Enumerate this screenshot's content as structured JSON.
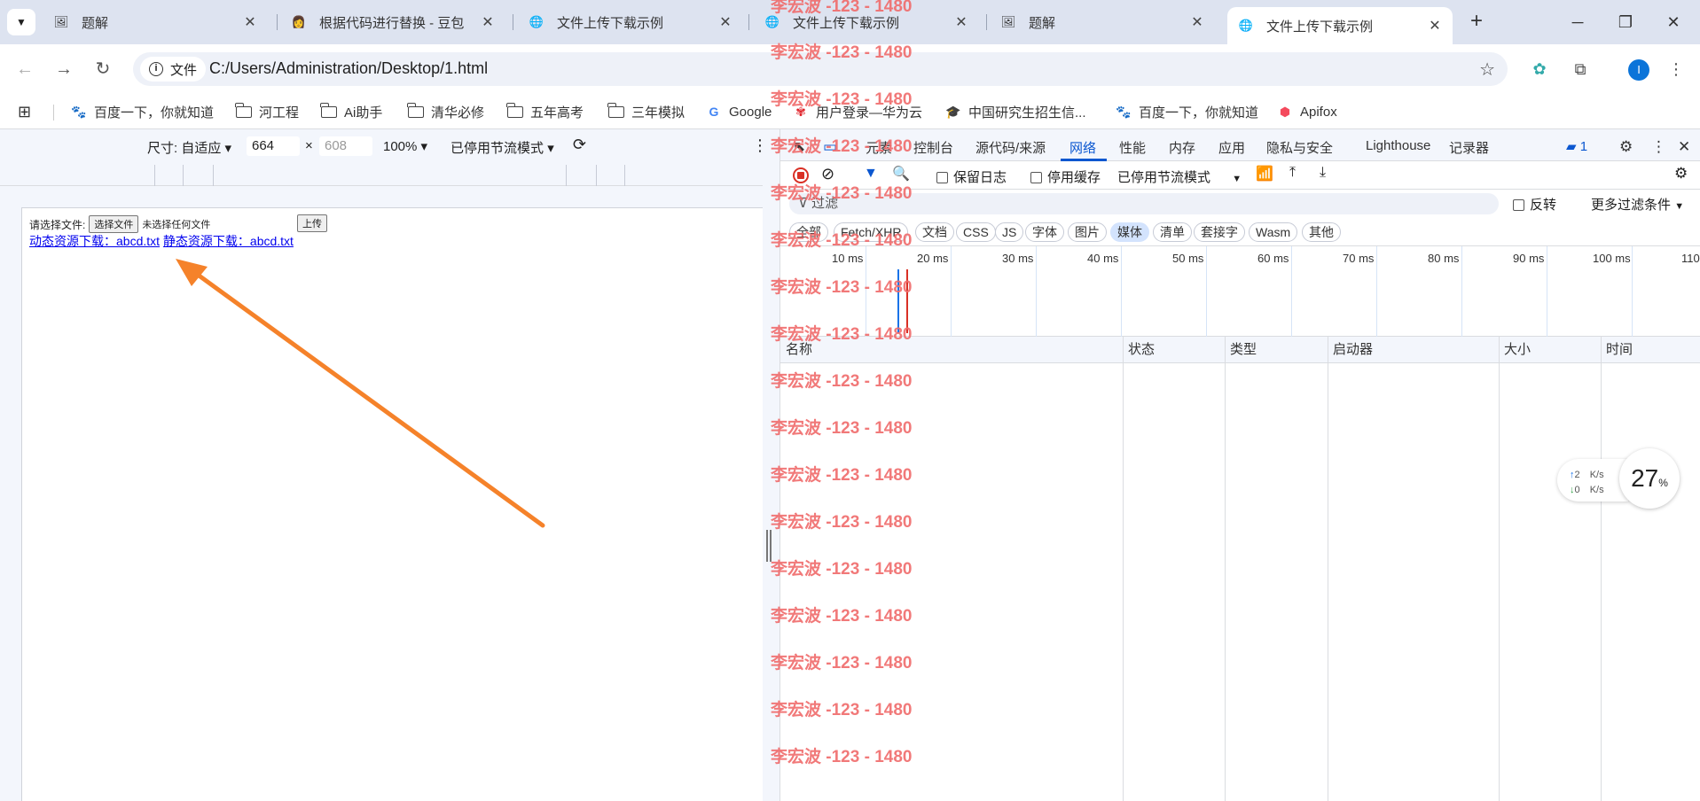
{
  "tabs": [
    {
      "title": "题解",
      "icon": "image-favicon"
    },
    {
      "title": "根据代码进行替换 - 豆包",
      "icon": "doubao-favicon"
    },
    {
      "title": "文件上传下载示例",
      "icon": "globe-icon"
    },
    {
      "title": "文件上传下载示例",
      "icon": "globe-icon"
    },
    {
      "title": "题解",
      "icon": "image-favicon"
    },
    {
      "title": "文件上传下载示例",
      "icon": "globe-icon",
      "active": true
    }
  ],
  "omnibox": {
    "chip_label": "文件",
    "url": "C:/Users/Administration/Desktop/1.html"
  },
  "profile_initial": "I",
  "bookmarks": [
    "百度一下，你就知道",
    "河工程",
    "Ai助手",
    "清华必修",
    "五年高考",
    "三年模拟",
    "Google",
    "用户登录—华为云",
    "中国研究生招生信...",
    "百度一下，你就知道",
    "Apifox"
  ],
  "device_toolbar": {
    "size_label": "尺寸: 自适应",
    "width": "664",
    "times": "×",
    "height": "608",
    "zoom": "100%",
    "throttle": "已停用节流模式"
  },
  "page": {
    "file_label": "请选择文件:",
    "choose_button": "选择文件",
    "no_file": "未选择任何文件",
    "upload_button": "上传",
    "dynamic_link": "动态资源下载：abcd.txt",
    "static_link": "静态资源下载：abcd.txt"
  },
  "devtools": {
    "tabs": [
      "元素",
      "控制台",
      "源代码/来源",
      "网络",
      "性能",
      "内存",
      "应用",
      "隐私与安全",
      "Lighthouse",
      "记录器"
    ],
    "active_tab": "网络",
    "issues_count": "1",
    "preserve_log": "保留日志",
    "disable_cache": "停用缓存",
    "throttle": "已停用节流模式",
    "filter_placeholder": "过滤",
    "invert": "反转",
    "more_filters": "更多过滤条件",
    "type_filters": [
      "全部",
      "Fetch/XHR",
      "文档",
      "CSS",
      "JS",
      "字体",
      "图片",
      "媒体",
      "清单",
      "套接字",
      "Wasm",
      "其他"
    ],
    "active_filter": "媒体",
    "timeline_ticks": [
      "10 ms",
      "20 ms",
      "30 ms",
      "40 ms",
      "50 ms",
      "60 ms",
      "70 ms",
      "80 ms",
      "90 ms",
      "100 ms",
      "110"
    ],
    "columns": [
      "名称",
      "状态",
      "类型",
      "启动器",
      "大小",
      "时间"
    ]
  },
  "watermark": "李宏波 -123 - 1480",
  "speed_widget": {
    "up": "2",
    "down": "0",
    "unit": "K/s",
    "percent": "27",
    "percent_sign": "%"
  },
  "colors": {
    "accent": "#0b57d0",
    "watermark": "#f06b6b",
    "arrow": "#f5822a"
  }
}
